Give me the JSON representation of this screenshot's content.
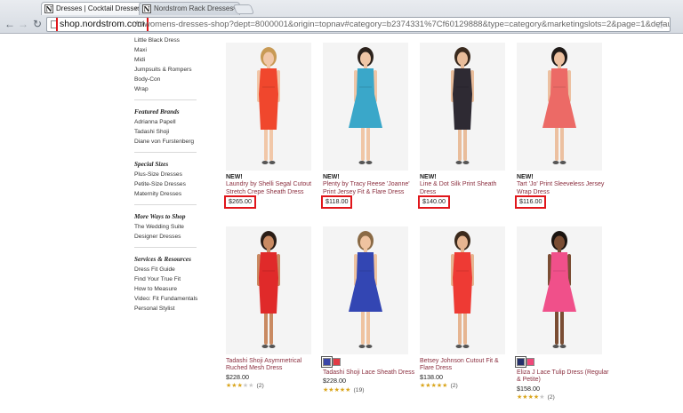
{
  "browser": {
    "tabs": [
      {
        "title": "Dresses | Cocktail Dresses",
        "active": true
      },
      {
        "title": "Nordstrom Rack Dresses &",
        "active": false
      }
    ],
    "favicon_letter": "N",
    "url_domain": "shop.nordstrom.com",
    "url_path": "/c/womens-dresses-shop?dept=8000001&origin=topnav#category=b2374331%7Cf60129888&type=category&marketingslots=2&page=1&defaultsize..."
  },
  "sidebar": {
    "top_links": [
      "Little Black Dress",
      "Maxi",
      "Midi",
      "Jumpsuits & Rompers",
      "Body-Con",
      "Wrap"
    ],
    "sections": [
      {
        "heading": "Featured Brands",
        "links": [
          "Adrianna Papell",
          "Tadashi Shoji",
          "Diane von Furstenberg"
        ]
      },
      {
        "heading": "Special Sizes",
        "links": [
          "Plus-Size Dresses",
          "Petite-Size Dresses",
          "Maternity Dresses"
        ]
      },
      {
        "heading": "More Ways to Shop",
        "links": [
          "The Wedding Suite",
          "Designer Dresses"
        ]
      },
      {
        "heading": "Services & Resources",
        "links": [
          "Dress Fit Guide",
          "Find Your True Fit",
          "How to Measure",
          "Video: Fit Fundamentals",
          "Personal Stylist"
        ]
      }
    ]
  },
  "products": [
    {
      "badge": "NEW!",
      "name": "Laundry by Shelli Segal Cutout Stretch Crepe Sheath Dress",
      "price": "$265.00",
      "highlighted": true,
      "dress_color": "#f0472d",
      "skin": "#f1c7a8",
      "hair": "#c89a55"
    },
    {
      "badge": "NEW!",
      "name": "Plenty by Tracy Reese 'Joanne' Print Jersey Fit & Flare Dress",
      "price": "$118.00",
      "highlighted": true,
      "dress_color": "#3aa7c9",
      "skin": "#f0c6a6",
      "hair": "#2c221c"
    },
    {
      "badge": "NEW!",
      "name": "Line & Dot Silk Print Sheath Dress",
      "price": "$140.00",
      "highlighted": true,
      "dress_color": "#2e2a33",
      "skin": "#e9bd9b",
      "hair": "#3a2a1e"
    },
    {
      "badge": "NEW!",
      "name": "Tart 'Jo' Print Sleeveless Jersey Wrap Dress",
      "price": "$116.00",
      "highlighted": true,
      "dress_color": "#ec6a66",
      "skin": "#ecc0a0",
      "hair": "#1f1a18"
    },
    {
      "badge": "",
      "name": "Tadashi Shoji Asymmetrical Ruched Mesh Dress",
      "price": "$228.00",
      "highlighted": false,
      "rating_stars": 3,
      "reviews": "(2)",
      "swatches": [],
      "dress_color": "#e02a2a",
      "skin": "#c98a62",
      "hair": "#2a1d16"
    },
    {
      "badge": "",
      "name": "Tadashi Shoji Lace Sheath Dress",
      "price": "$228.00",
      "highlighted": false,
      "rating_stars": 4.5,
      "reviews": "(19)",
      "swatches": [
        "#3a46a8",
        "#e23a44"
      ],
      "dress_color": "#3346b3",
      "skin": "#efc3a0",
      "hair": "#8a6a45"
    },
    {
      "badge": "",
      "name": "Betsey Johnson Cutout Fit & Flare Dress",
      "price": "$138.00",
      "highlighted": false,
      "rating_stars": 4.5,
      "reviews": "(2)",
      "swatches": [],
      "dress_color": "#ee3a34",
      "skin": "#e6b591",
      "hair": "#3b2a1c"
    },
    {
      "badge": "",
      "name": "Eliza J Lace Tulip Dress (Regular & Petite)",
      "price": "$158.00",
      "highlighted": false,
      "rating_stars": 4,
      "reviews": "(2)",
      "swatches": [
        "#24306b",
        "#f0487a"
      ],
      "dress_color": "#f0508a",
      "skin": "#7a4d33",
      "hair": "#1a1410"
    }
  ]
}
